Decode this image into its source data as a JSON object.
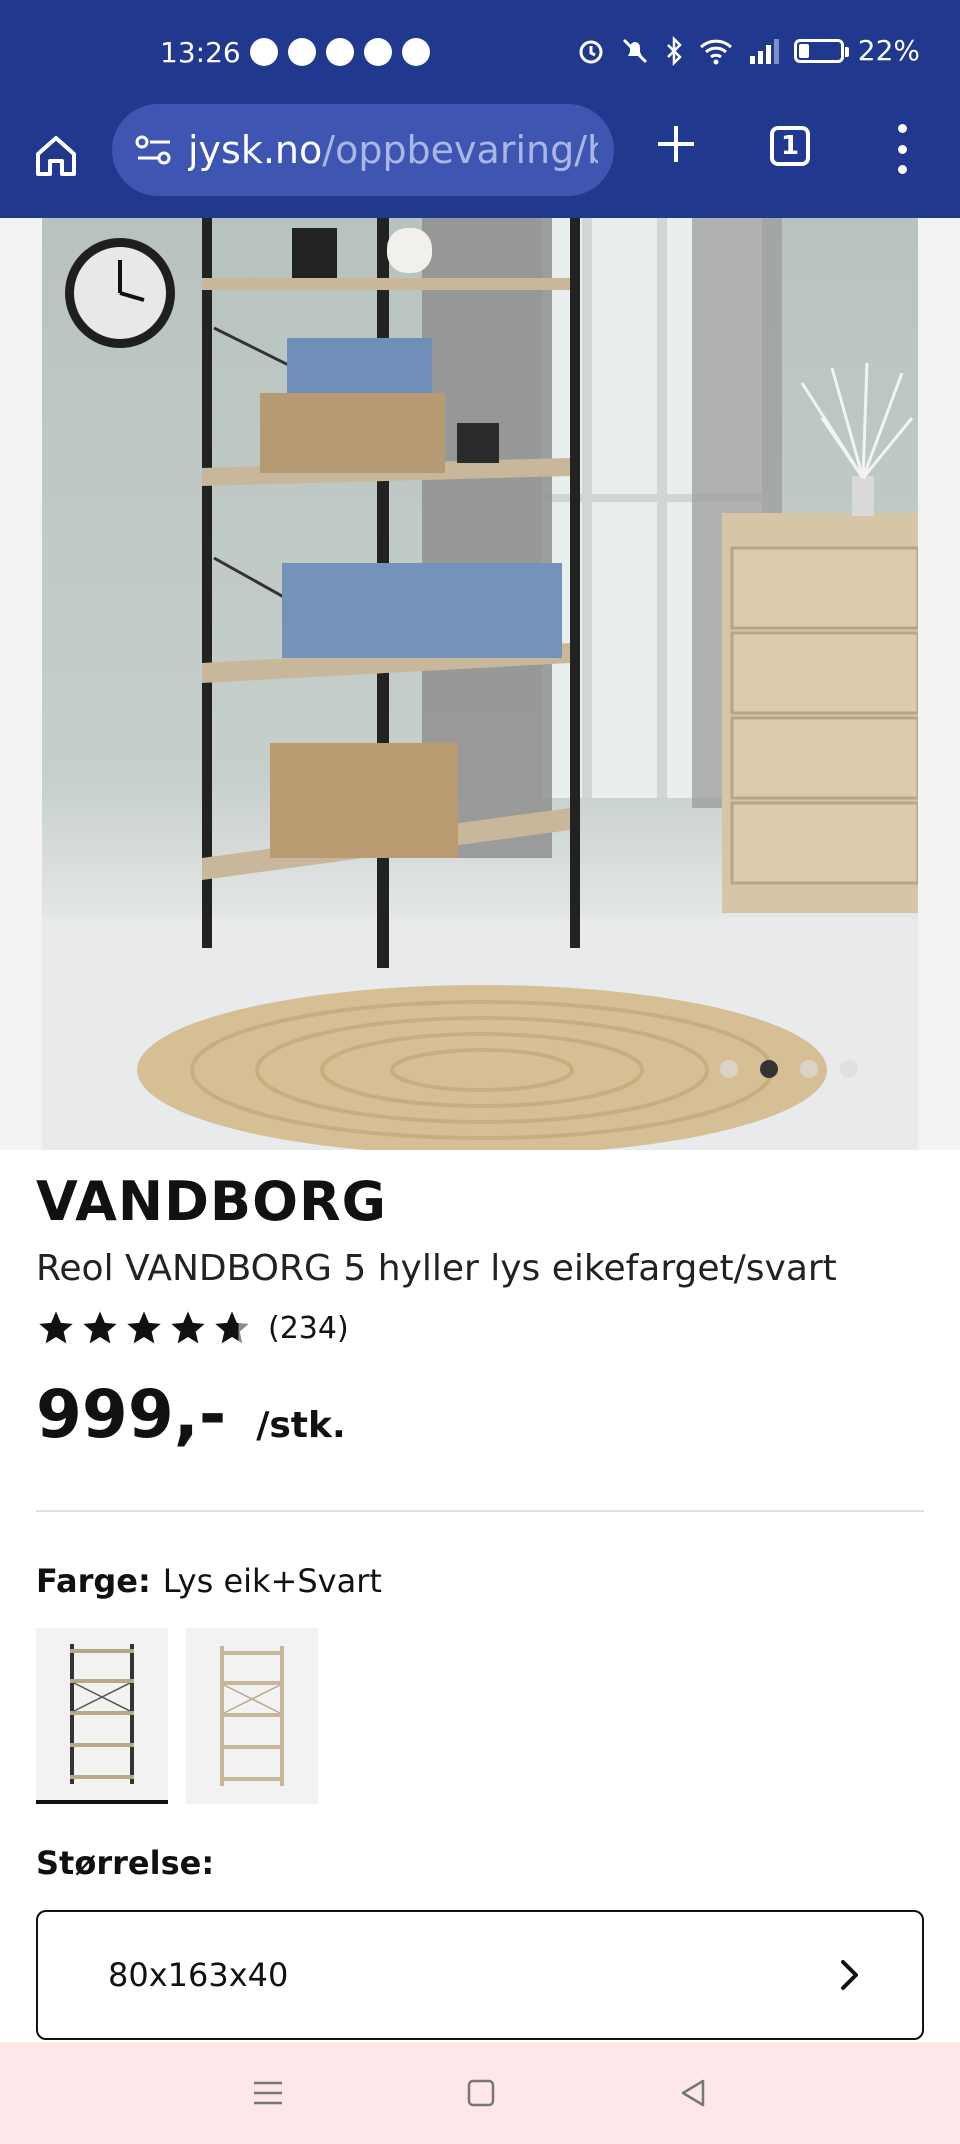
{
  "status_bar": {
    "time": "13:26",
    "battery": "22%",
    "app_icons": [
      "messenger-icon",
      "instagram-icon",
      "app-icon",
      "app-icon",
      "app-icon"
    ],
    "system_icons": [
      "alarm-icon",
      "mute-icon",
      "bluetooth-icon",
      "wifi-icon",
      "signal-icon",
      "battery-icon"
    ]
  },
  "browser": {
    "url_host": "jysk.no",
    "url_path": "/oppbevaring/bok",
    "tab_count": "1"
  },
  "gallery": {
    "dot_count": 4,
    "active_dot": 2
  },
  "product": {
    "brand": "VANDBORG",
    "name": "Reol VANDBORG 5 hyller lys eikefarget/svart",
    "rating_stars": 4.5,
    "rating_count": "(234)",
    "price": "999,-",
    "unit": "/stk.",
    "color_label": "Farge:",
    "color_value": "Lys eik+Svart",
    "size_label": "Størrelse:",
    "size_value": "80x163x40"
  },
  "colors": {
    "brand_bar": "#21388f",
    "url_box": "#3e56b1",
    "nav_bar": "#fde7e8"
  }
}
